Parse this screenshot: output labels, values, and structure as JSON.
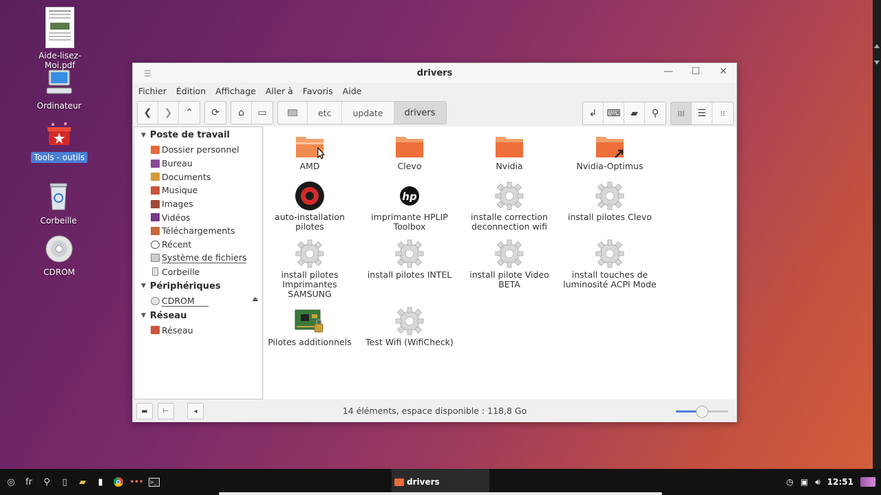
{
  "desktop": {
    "icons": [
      {
        "label": "Aide-lisez-Moi.pdf",
        "icon": "pdf-document-icon"
      },
      {
        "label": "Ordinateur",
        "icon": "computer-icon"
      },
      {
        "label": "Tools - outils",
        "icon": "toolbox-icon",
        "selected": true
      },
      {
        "label": "Corbeille",
        "icon": "trash-icon"
      },
      {
        "label": "CDROM",
        "icon": "cdrom-icon"
      }
    ]
  },
  "window": {
    "title": "drivers",
    "menu": [
      "Fichier",
      "Édition",
      "Affichage",
      "Aller à",
      "Favoris",
      "Aide"
    ],
    "path": [
      "etc",
      "update",
      "drivers"
    ],
    "sidebar": {
      "sections": [
        {
          "label": "Poste de travail",
          "items": [
            "Dossier personnel",
            "Bureau",
            "Documents",
            "Musique",
            "Images",
            "Vidéos",
            "Téléchargements",
            "Récent",
            "Système de fichiers",
            "Corbeille"
          ]
        },
        {
          "label": "Périphériques",
          "items": [
            "CDROM"
          ]
        },
        {
          "label": "Réseau",
          "items": [
            "Réseau"
          ]
        }
      ]
    },
    "files": [
      {
        "label": "AMD",
        "icon": "folder-icon"
      },
      {
        "label": "Clevo",
        "icon": "folder-icon"
      },
      {
        "label": "Nvidia",
        "icon": "folder-icon"
      },
      {
        "label": "Nvidia-Optimus",
        "icon": "folder-link-icon"
      },
      {
        "label": "auto-installation pilotes",
        "icon": "driver-installer-icon"
      },
      {
        "label": "imprimante HPLIP Toolbox",
        "icon": "hp-logo-icon"
      },
      {
        "label": "installe correction deconnection wifi",
        "icon": "gear-icon"
      },
      {
        "label": "install pilotes Clevo",
        "icon": "gear-icon"
      },
      {
        "label": "install pilotes Imprimantes SAMSUNG",
        "icon": "gear-icon"
      },
      {
        "label": "install pilotes INTEL",
        "icon": "gear-icon"
      },
      {
        "label": "install pilote Video BETA",
        "icon": "gear-icon"
      },
      {
        "label": "install touches de luminosité ACPI Mode",
        "icon": "gear-icon"
      },
      {
        "label": "Pilotes additionnels",
        "icon": "circuit-board-icon"
      },
      {
        "label": "Test Wifi (WifiCheck)",
        "icon": "gear-icon"
      }
    ],
    "status": "14 éléments, espace disponible : 118,8 Go",
    "zoom_level": 0.5
  },
  "taskbar": {
    "lang": "fr",
    "active_window": "drivers",
    "clock": "12:51"
  },
  "colors": {
    "folder": "#e8693a",
    "selection": "#4a7fd4",
    "taskbar": "#121212"
  }
}
